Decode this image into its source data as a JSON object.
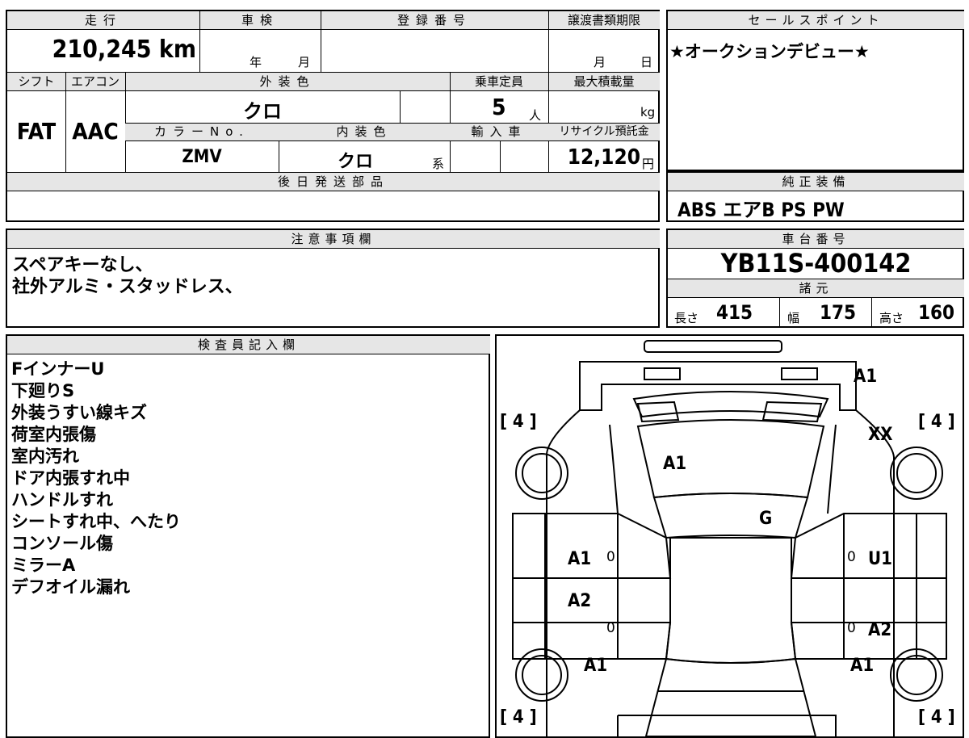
{
  "top": {
    "headers": {
      "mileage": "走行",
      "inspection": "車検",
      "registration": "登録番号",
      "transfer_deadline": "譲渡書類期限",
      "sales_point": "セールスポイント"
    },
    "mileage_value": "210,245 km",
    "inspection_year": "年",
    "inspection_month": "月",
    "transfer_month": "月",
    "transfer_day": "日",
    "sales_point_text": "★オークションデビュー★"
  },
  "spec": {
    "headers": {
      "shift": "シフト",
      "aircon": "エアコン",
      "exterior_color": "外装色",
      "capacity": "乗車定員",
      "max_load": "最大積載量",
      "color_no": "カラーNo.",
      "interior_color": "内装色",
      "import": "輸入車",
      "recycle": "リサイクル預託金"
    },
    "shift": "FAT",
    "aircon": "AAC",
    "exterior_color": "クロ",
    "capacity": "5",
    "capacity_unit": "人",
    "max_load_unit": "kg",
    "color_no": "ZMV",
    "interior_color": "クロ",
    "interior_suffix": "系",
    "recycle_fee": "12,120",
    "recycle_unit": "円"
  },
  "later_parts": {
    "header": "後日発送部品",
    "text": ""
  },
  "equipment": {
    "header": "純正装備",
    "text": "ABS エアB PS PW"
  },
  "notes": {
    "header": "注意事項欄",
    "lines": [
      "スペアキーなし、",
      "社外アルミ・スタッドレス、"
    ]
  },
  "chassis": {
    "header": "車台番号",
    "number": "YB11S-400142",
    "dims_header": "諸元",
    "length_label": "長さ",
    "length": "415",
    "width_label": "幅",
    "width": "175",
    "height_label": "高さ",
    "height": "160"
  },
  "inspector": {
    "header": "検査員記入欄",
    "lines": [
      "FインナーU",
      "下廻りS",
      "外装うすい線キズ",
      "荷室内張傷",
      "室内汚れ",
      "ドア内張すれ中",
      "ハンドルすれ",
      "シートすれ中、へたり",
      "コンソール傷",
      "ミラーA",
      "デフオイル漏れ"
    ]
  },
  "diagram": {
    "tire_front_left": "[ 4 ]",
    "tire_front_right": "[ 4 ]",
    "tire_rear_left": "[ 4 ]",
    "tire_rear_right": "[ 4 ]",
    "marks": {
      "rear_bumper": "A1",
      "rear_right": "XX",
      "rear_glass": "A1",
      "roof": "G",
      "left_rear_door": "A1",
      "right_rear_door": "U1",
      "left_front_door": "A2",
      "right_front_door": "A2",
      "left_front_fender": "A1",
      "right_front_fender": "A1",
      "zero_1": "0",
      "zero_2": "0",
      "zero_3": "0",
      "zero_4": "0"
    }
  }
}
